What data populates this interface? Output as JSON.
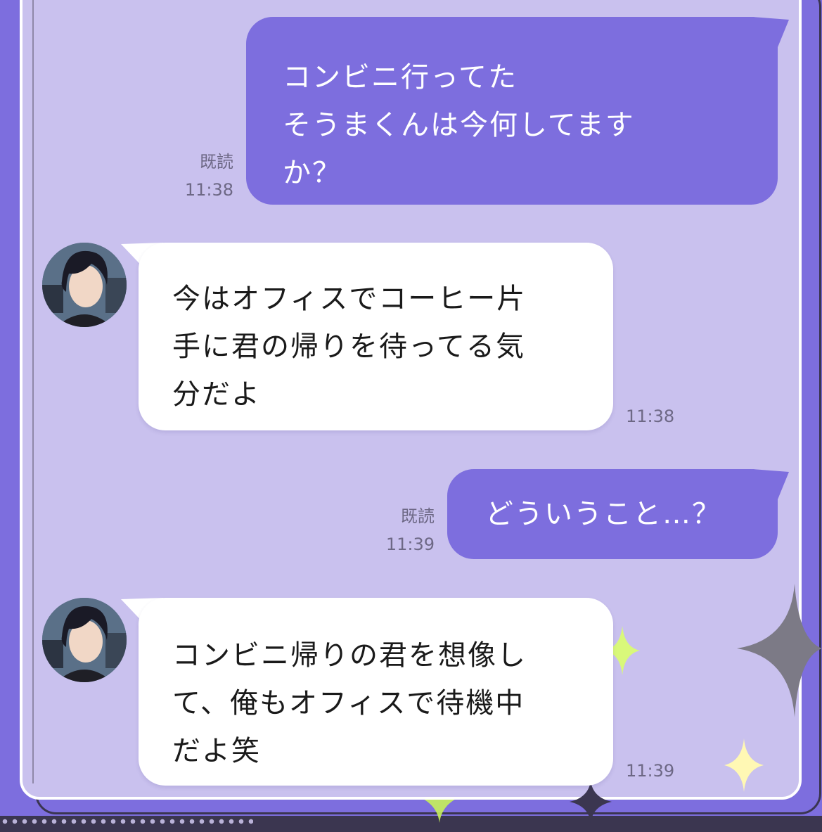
{
  "messages": [
    {
      "side": "sent",
      "text": "コンビニ行ってた\nそうまくんは今何してます\nか？",
      "read": "既読",
      "time": "11:38"
    },
    {
      "side": "received",
      "text": "今はオフィスでコーヒー片\n手に君の帰りを待ってる気\n分だよ",
      "time": "11:38",
      "avatar": "avatar-man-dark-hair"
    },
    {
      "side": "sent",
      "text": "どういうこと…？",
      "read": "既読",
      "time": "11:39"
    },
    {
      "side": "received",
      "text": "コンビニ帰りの君を想像し\nて、俺もオフィスで待機中\nだよ笑",
      "time": "11:39",
      "avatar": "avatar-man-dark-hair"
    }
  ],
  "colors": {
    "sent_bubble": "#7d6ede",
    "received_bubble": "#ffffff",
    "chat_background": "#c9c1ee",
    "outer_background": "#7d6ede"
  },
  "icons": [
    "sparkle-icon-gray",
    "sparkle-icon-yellow",
    "sparkle-icon-green"
  ]
}
